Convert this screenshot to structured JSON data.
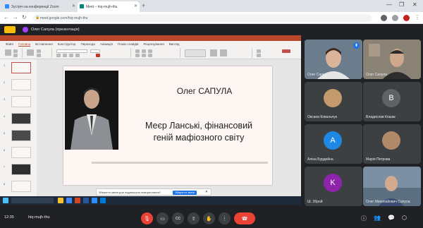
{
  "browser": {
    "tabs": [
      {
        "label": "Зустріч на конференції Zoom",
        "active": false
      },
      {
        "label": "Meet – hiq-mujh-thu",
        "active": true
      }
    ],
    "new_tab_icon": "plus-icon",
    "address": "meet.google.com/hiq-mujh-thu",
    "window_controls": [
      "—",
      "❐",
      "✕"
    ]
  },
  "meet": {
    "presenting_label": "Олег Сапула (презентація)",
    "meeting_code": "hiq-mujh-thu",
    "time": "12:35"
  },
  "powerpoint": {
    "ribbon_tabs": [
      "Файл",
      "Головна",
      "Вставлення",
      "Конструктор",
      "Переходи",
      "Анімація",
      "Показ слайдів",
      "Рецензування",
      "Вигляд"
    ],
    "thumbnails": [
      "1",
      "2",
      "3",
      "4",
      "5",
      "6",
      "7",
      "8"
    ],
    "slide": {
      "author": "Олег САПУЛА",
      "title_line1": "Меєр Ланські, фінансовий",
      "title_line2": "геній мафіозного світу"
    },
    "notification": {
      "text": "Зберегти зміни для подальшого використання?",
      "button": "Зберегти зміни",
      "close": "✕"
    }
  },
  "participants": [
    {
      "name": "Олег Сапула",
      "type": "video",
      "speaking": true
    },
    {
      "name": "Олег Сапула",
      "type": "video",
      "speaking": false
    },
    {
      "name": "Оксана Ковальчук",
      "type": "photo",
      "avatar_color": "#c49a6c"
    },
    {
      "name": "Владислав Кошак",
      "type": "letter",
      "letter": "B",
      "avatar_color": "#5f6368"
    },
    {
      "name": "Аліна Бурдейна",
      "type": "letter",
      "letter": "A",
      "avatar_color": "#1e88e5"
    },
    {
      "name": "Марія Петрова",
      "type": "photo",
      "avatar_color": "#b08968"
    },
    {
      "name": "Ш. Зброй",
      "type": "letter",
      "letter": "K",
      "avatar_color": "#8e24aa"
    },
    {
      "name": "Олег Миколайович Сапула",
      "type": "video",
      "speaking": false
    }
  ],
  "controls": {
    "mic": "mic-off-icon",
    "camera": "camera-icon",
    "captions": "captions-icon",
    "present": "present-icon",
    "hand": "hand-icon",
    "more": "more-icon",
    "leave": "end-call-icon"
  },
  "colors": {
    "meet_bg": "#202124",
    "tile_bg": "#3c4043",
    "end_call": "#ea4335",
    "powerpoint_accent": "#b7472a",
    "slide_bg": "#fdf6f2"
  }
}
